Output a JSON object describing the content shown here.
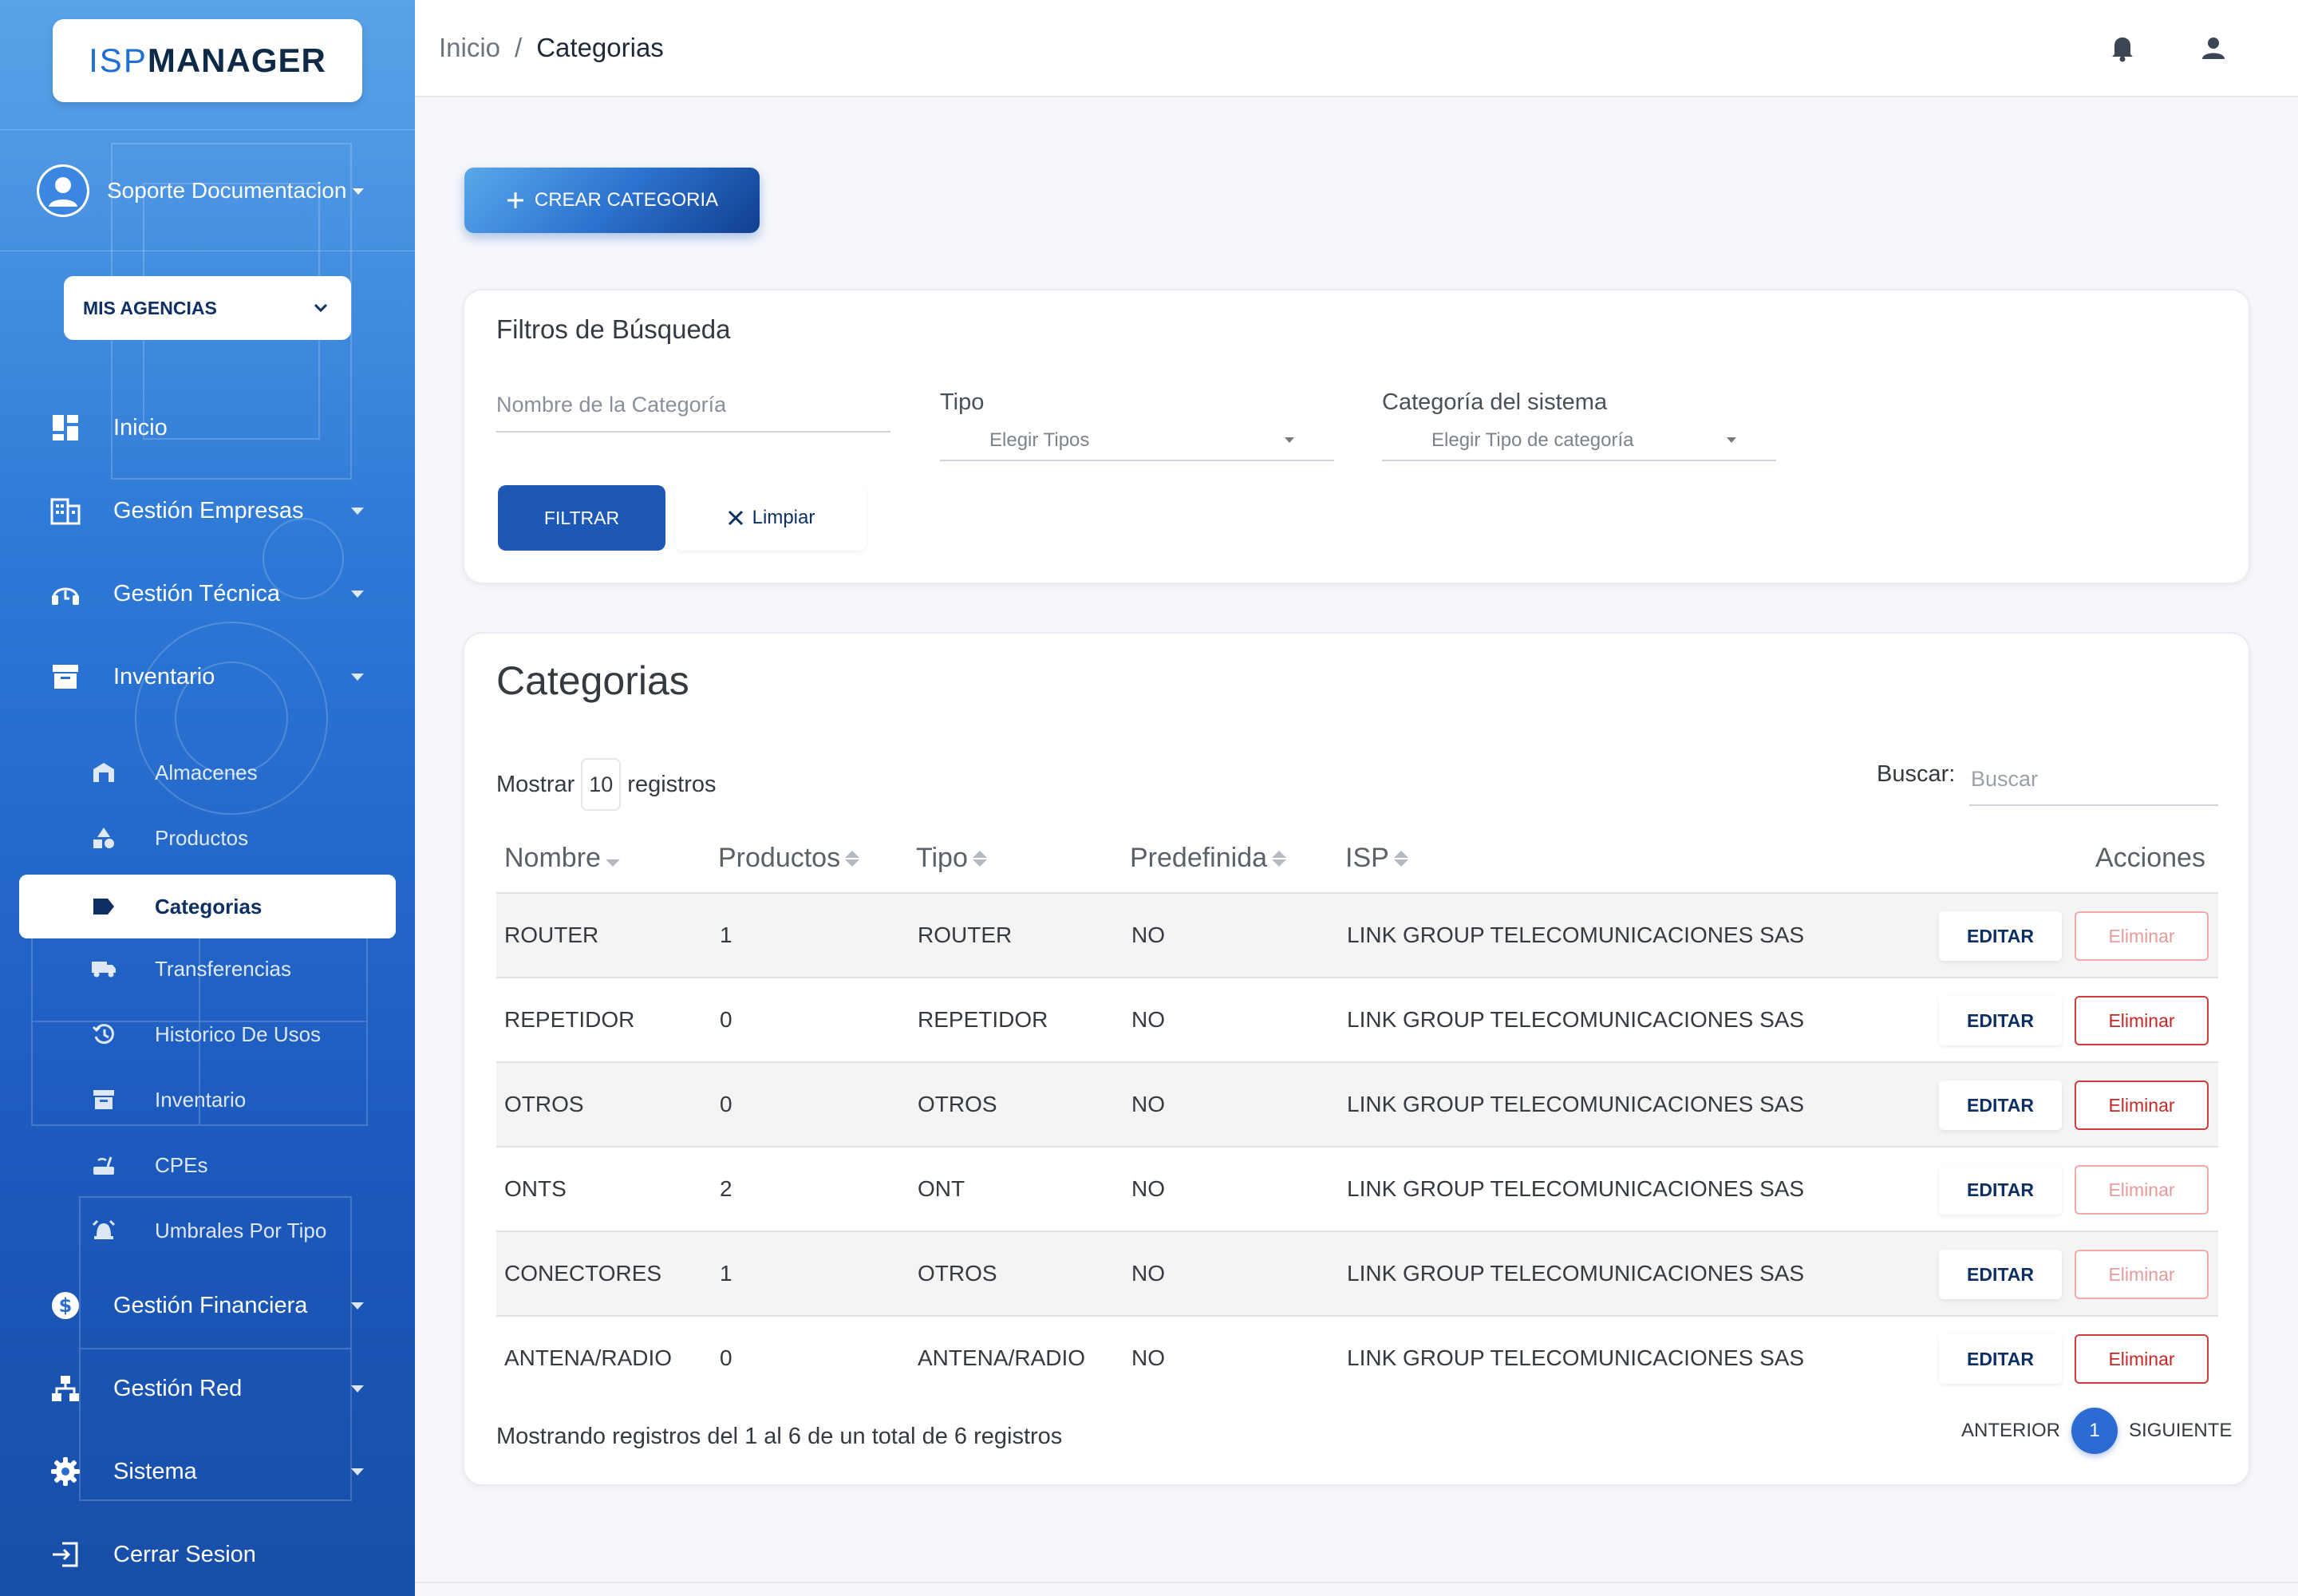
{
  "app": {
    "logo_prefix": "ISP",
    "logo_suffix": "MANAGER",
    "accent": "#1e58b6"
  },
  "sidebar": {
    "user_name": "Soporte Documentacion",
    "agency_select": "MIS AGENCIAS",
    "items": [
      {
        "label": "Inicio",
        "icon": "dashboard-icon"
      },
      {
        "label": "Gestión Empresas",
        "icon": "building-icon"
      },
      {
        "label": "Gestión Técnica",
        "icon": "headset-icon"
      },
      {
        "label": "Inventario",
        "icon": "archive-icon"
      },
      {
        "label": "Gestión Financiera",
        "icon": "dollar-icon"
      },
      {
        "label": "Gestión Red",
        "icon": "network-icon"
      },
      {
        "label": "Sistema",
        "icon": "gear-icon"
      },
      {
        "label": "Cerrar Sesion",
        "icon": "logout-icon"
      }
    ],
    "sub_items": [
      {
        "label": "Almacenes",
        "icon": "warehouse-icon"
      },
      {
        "label": "Productos",
        "icon": "shapes-icon"
      },
      {
        "label": "Categorias",
        "icon": "tag-icon"
      },
      {
        "label": "Transferencias",
        "icon": "truck-icon"
      },
      {
        "label": "Historico De Usos",
        "icon": "history-icon"
      },
      {
        "label": "Inventario",
        "icon": "archive-icon"
      },
      {
        "label": "CPEs",
        "icon": "router-icon"
      },
      {
        "label": "Umbrales Por Tipo",
        "icon": "alarm-icon"
      }
    ]
  },
  "topbar": {
    "breadcrumb_home": "Inicio",
    "breadcrumb_sep": "/",
    "breadcrumb_current": "Categorias"
  },
  "actions": {
    "create_label": "CREAR CATEGORIA"
  },
  "filters": {
    "title": "Filtros de Búsqueda",
    "name_placeholder": "Nombre de la Categoría",
    "tipo_label": "Tipo",
    "tipo_value": "Elegir Tipos",
    "sistema_label": "Categoría del sistema",
    "sistema_value": "Elegir Tipo de categoría",
    "filter_button": "FILTRAR",
    "clear_button": "Limpiar"
  },
  "table": {
    "title": "Categorias",
    "show_prefix": "Mostrar",
    "page_length": "10",
    "show_suffix": "registros",
    "search_label": "Buscar:",
    "search_placeholder": "Buscar",
    "columns": [
      "Nombre",
      "Productos",
      "Tipo",
      "Predefinida",
      "ISP",
      "Acciones"
    ],
    "edit_label": "EDITAR",
    "delete_label": "Eliminar",
    "rows": [
      {
        "nombre": "ROUTER",
        "productos": "1",
        "tipo": "ROUTER",
        "predefinida": "NO",
        "isp": "LINK GROUP TELECOMUNICACIONES SAS",
        "delete_enabled": false
      },
      {
        "nombre": "REPETIDOR",
        "productos": "0",
        "tipo": "REPETIDOR",
        "predefinida": "NO",
        "isp": "LINK GROUP TELECOMUNICACIONES SAS",
        "delete_enabled": true
      },
      {
        "nombre": "OTROS",
        "productos": "0",
        "tipo": "OTROS",
        "predefinida": "NO",
        "isp": "LINK GROUP TELECOMUNICACIONES SAS",
        "delete_enabled": true
      },
      {
        "nombre": "ONTS",
        "productos": "2",
        "tipo": "ONT",
        "predefinida": "NO",
        "isp": "LINK GROUP TELECOMUNICACIONES SAS",
        "delete_enabled": false
      },
      {
        "nombre": "CONECTORES",
        "productos": "1",
        "tipo": "OTROS",
        "predefinida": "NO",
        "isp": "LINK GROUP TELECOMUNICACIONES SAS",
        "delete_enabled": false
      },
      {
        "nombre": "ANTENA/RADIO",
        "productos": "0",
        "tipo": "ANTENA/RADIO",
        "predefinida": "NO",
        "isp": "LINK GROUP TELECOMUNICACIONES SAS",
        "delete_enabled": true
      }
    ],
    "footer_info": "Mostrando registros del 1 al 6 de un total de 6 registros",
    "prev_label": "ANTERIOR",
    "current_page": "1",
    "next_label": "SIGUIENTE"
  }
}
